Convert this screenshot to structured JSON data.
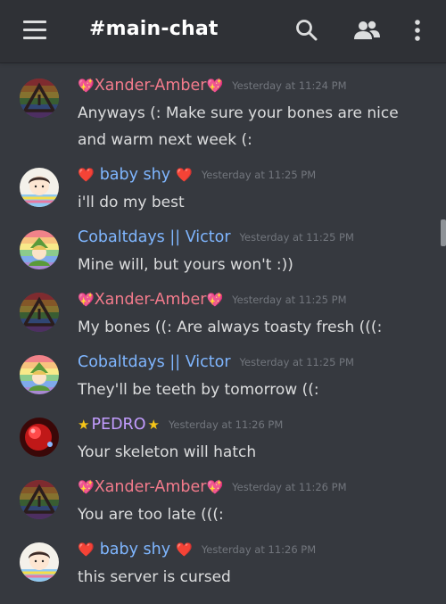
{
  "header": {
    "menu_icon": "hamburger-menu-icon",
    "channel_title": "#main-chat",
    "search_icon": "search-icon",
    "members_icon": "members-icon",
    "overflow_icon": "more-vertical-icon"
  },
  "colors": {
    "background": "#36393f",
    "header_bg": "#2f3136",
    "text": "#dcddde",
    "timestamp": "#72767d",
    "xander": "#f47b8c",
    "babyshy": "#7fb6ff",
    "cobalt": "#7fb6ff",
    "pedro": "#c39dff"
  },
  "messages": [
    {
      "author": "Xander-Amber",
      "prefix": "💖",
      "suffix": "💖",
      "timestamp": "Yesterday at 11:24 PM",
      "text": "Anyways (: Make sure your bones are nice and warm next week (:"
    },
    {
      "author": "baby shy",
      "prefix": "❤️",
      "suffix": "❤️",
      "timestamp": "Yesterday at 11:25 PM",
      "text": "i'll do my best"
    },
    {
      "author": "Cobaltdays || Victor",
      "prefix": "",
      "suffix": "",
      "timestamp": "Yesterday at 11:25 PM",
      "text": "Mine will, but yours won't :))"
    },
    {
      "author": "Xander-Amber",
      "prefix": "💖",
      "suffix": "💖",
      "timestamp": "Yesterday at 11:25 PM",
      "text": "My bones ((: Are always toasty fresh (((:"
    },
    {
      "author": "Cobaltdays || Victor",
      "prefix": "",
      "suffix": "",
      "timestamp": "Yesterday at 11:25 PM",
      "text": "They'll be teeth by tomorrow ((:"
    },
    {
      "author": "PEDRO",
      "prefix": "★",
      "suffix": "★",
      "timestamp": "Yesterday at 11:26 PM",
      "text": "Your skeleton will hatch"
    },
    {
      "author": "Xander-Amber",
      "prefix": "💖",
      "suffix": "💖",
      "timestamp": "Yesterday at 11:26 PM",
      "text": "You are too late (((:"
    },
    {
      "author": "baby shy",
      "prefix": "❤️",
      "suffix": "❤️",
      "timestamp": "Yesterday at 11:26 PM",
      "text": "this server is cursed"
    }
  ]
}
